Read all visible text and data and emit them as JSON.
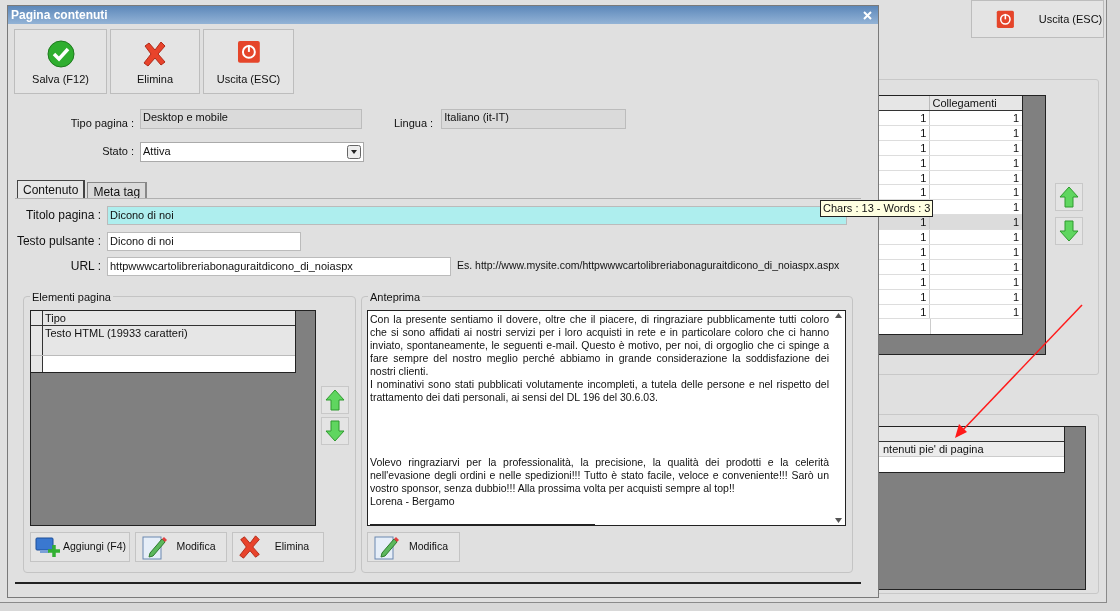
{
  "background": {
    "exit_button": {
      "kind": "exit",
      "label": "Uscita (ESC)"
    },
    "table": {
      "columns": [
        "Collegamenti"
      ],
      "rows": [
        {
          "column_1": "1",
          "collegamenti": "1",
          "selected": false
        },
        {
          "column_1": "1",
          "collegamenti": "1",
          "selected": false
        },
        {
          "column_1": "1",
          "collegamenti": "1",
          "selected": false
        },
        {
          "column_1": "1",
          "collegamenti": "1",
          "selected": false
        },
        {
          "column_1": "1",
          "collegamenti": "1",
          "selected": false
        },
        {
          "column_1": "1",
          "collegamenti": "1",
          "selected": false
        },
        {
          "collegamenti": "1",
          "selected": false
        },
        {
          "column_1": "1",
          "collegamenti": "1",
          "selected": true
        },
        {
          "column_1": "1",
          "collegamenti": "1",
          "selected": false
        },
        {
          "column_1": "1",
          "collegamenti": "1",
          "selected": false
        },
        {
          "column_1": "1",
          "collegamenti": "1",
          "selected": false
        },
        {
          "column_1": "1",
          "collegamenti": "1",
          "selected": false
        },
        {
          "column_1": "1",
          "collegamenti": "1",
          "selected": false
        },
        {
          "column_1": "1",
          "collegamenti": "1",
          "selected": false
        }
      ]
    },
    "footer_table": {
      "rows": [
        "ntenuti pie' di pagina"
      ]
    }
  },
  "dialog": {
    "title": "Pagina contenuti",
    "toolbar": [
      {
        "kind": "save",
        "label": "Salva (F12)"
      },
      {
        "kind": "delete",
        "label": "Elimina"
      },
      {
        "kind": "exit",
        "label": "Uscita (ESC)"
      }
    ],
    "tipo_pagina": {
      "label": "Tipo pagina :",
      "value": "Desktop e mobile"
    },
    "lingua": {
      "label": "Lingua :",
      "value": "Italiano (it-IT)"
    },
    "stato": {
      "label": "Stato :",
      "value": "Attiva"
    },
    "tabs": [
      {
        "label": "Contenuto",
        "selected": true
      },
      {
        "label": "Meta tag",
        "selected": false
      }
    ],
    "titolo_pagina": {
      "label": "Titolo pagina :",
      "value": "Dicono di noi"
    },
    "tooltip": "Chars : 13 - Words : 3",
    "testo_pulsante": {
      "label": "Testo pulsante :",
      "value": "Dicono di noi"
    },
    "url": {
      "label": "URL :",
      "value": "httpwwwcartolibreriabonaguraitdicono_di_noiaspx",
      "hint": "Es. http://www.mysite.com/httpwwwcartolibreriabonaguraitdicono_di_noiaspx.aspx"
    },
    "elementi": {
      "title": "Elementi pagina",
      "columns": [
        "Tipo"
      ],
      "rows": [
        {
          "tipo": "Testo HTML (19933 caratteri)"
        }
      ],
      "buttons": [
        {
          "kind": "add",
          "label": "Aggiungi (F4)"
        },
        {
          "kind": "edit",
          "label": "Modifica"
        },
        {
          "kind": "delete",
          "label": "Elimina"
        }
      ]
    },
    "anteprima": {
      "title": "Anteprima",
      "blocks": [
        [
          "Con la presente sentiamo il dovere, oltre che il piacere, di ringraziare pubblicamente tutti coloro che si sono affidati ai nostri servizi per i loro acquisti in rete e in particolare coloro che ci hanno inviato, spontaneamente, le seguenti e-mail. Questo è motivo, per noi, di orgoglio che ci spinge a fare sempre del nostro meglio perché abbiamo in grande considerazione la soddisfazione dei nostri clienti.",
          "I nominativi sono stati pubblicati volutamente incompleti, a tutela delle persone e nel rispetto del trattamento dei dati personali, ai sensi del DL 196 del 30.6.03."
        ],
        [
          "Volevo ringraziarvi per la professionalità, la precisione, la qualità dei prodotti e la celerità nell'evasione degli ordini e nelle spedizioni!!! Tutto è stato facile, veloce e conveniente!!! Sarò un vostro sponsor, senza dubbio!!! Alla prossima volta per acquisti sempre al top!!",
          "Lorena - Bergamo"
        ]
      ],
      "button": {
        "kind": "edit",
        "label": "Modifica"
      }
    }
  }
}
